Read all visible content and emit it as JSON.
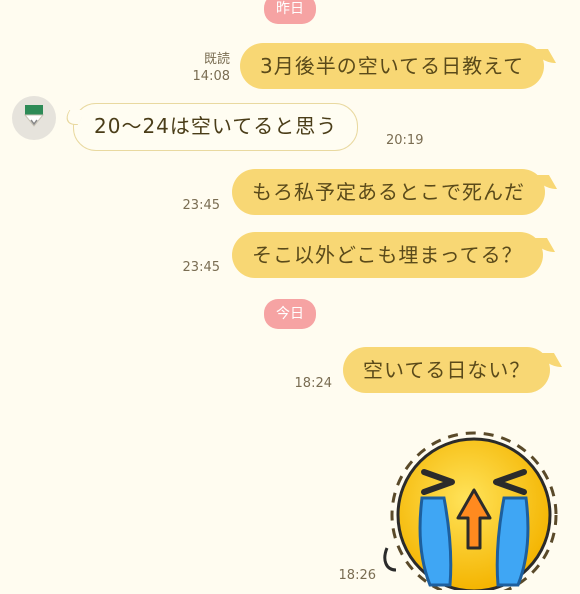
{
  "chat": {
    "date_yesterday": "昨日",
    "date_today": "今日",
    "messages": [
      {
        "text": "3月後半の空いてる日教えて",
        "read": "既読",
        "time": "14:08"
      },
      {
        "text": "20〜24は空いてると思う",
        "time": "20:19"
      },
      {
        "text": "もろ私予定あるとこで死んだ",
        "time": "23:45"
      },
      {
        "text": "そこ以外どこも埋まってる？",
        "time": "23:45"
      },
      {
        "text": "空いてる日ない？",
        "time": "18:24"
      },
      {
        "time": "18:26",
        "sticker": "crying-face-sticker"
      }
    ]
  },
  "colors": {
    "background": "#fffcf0",
    "outgoing_bubble": "#f8d774",
    "date_pill": "#f6a3a3"
  }
}
